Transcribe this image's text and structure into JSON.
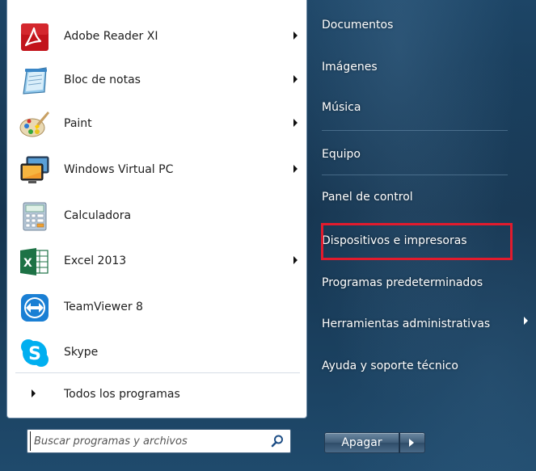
{
  "programs": [
    {
      "label": "Adobe Reader XI",
      "icon": "adobe-reader-icon",
      "has_submenu": true
    },
    {
      "label": "Bloc de notas",
      "icon": "notepad-icon",
      "has_submenu": true
    },
    {
      "label": "Paint",
      "icon": "paint-icon",
      "has_submenu": true
    },
    {
      "label": "Windows Virtual PC",
      "icon": "virtual-pc-icon",
      "has_submenu": true
    },
    {
      "label": "Calculadora",
      "icon": "calculator-icon",
      "has_submenu": false
    },
    {
      "label": "Excel 2013",
      "icon": "excel-icon",
      "has_submenu": true
    },
    {
      "label": "TeamViewer 8",
      "icon": "teamviewer-icon",
      "has_submenu": false
    },
    {
      "label": "Skype",
      "icon": "skype-icon",
      "has_submenu": false
    }
  ],
  "all_programs": {
    "label": "Todos los programas"
  },
  "search": {
    "placeholder": "Buscar programas y archivos"
  },
  "places": [
    {
      "label": "Documentos"
    },
    {
      "label": "Imágenes"
    },
    {
      "label": "Música"
    },
    {
      "label": "Equipo"
    },
    {
      "label": "Panel de control"
    },
    {
      "label": "Dispositivos e impresoras"
    },
    {
      "label": "Programas predeterminados"
    },
    {
      "label": "Herramientas administrativas"
    },
    {
      "label": "Ayuda y soporte técnico"
    }
  ],
  "shutdown": {
    "label": "Apagar"
  },
  "colors": {
    "highlight": "#e21b2d",
    "menu_blue": "#1d4566"
  }
}
